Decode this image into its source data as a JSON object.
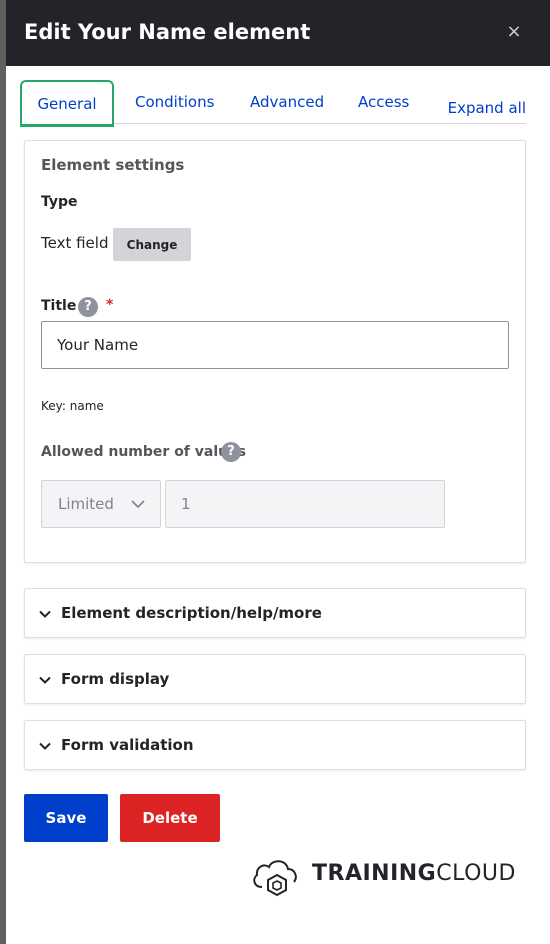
{
  "dialog": {
    "title": "Edit Your Name element",
    "close_glyph": "×"
  },
  "tabs": [
    {
      "label": "General",
      "active": true
    },
    {
      "label": "Conditions",
      "active": false
    },
    {
      "label": "Advanced",
      "active": false
    },
    {
      "label": "Access",
      "active": false
    }
  ],
  "expand_all_label": "Expand all",
  "element_settings": {
    "heading": "Element settings",
    "type_label": "Type",
    "type_value": "Text field",
    "change_button": "Change",
    "title_label": "Title",
    "help_glyph": "?",
    "required_mark": "*",
    "title_value": "Your Name",
    "key_text": "Key: name",
    "allowed_values_label": "Allowed number of values",
    "limit_select_value": "Limited",
    "limit_number_value": "1"
  },
  "sections": [
    {
      "label": "Element description/help/more"
    },
    {
      "label": "Form display"
    },
    {
      "label": "Form validation"
    }
  ],
  "actions": {
    "save": "Save",
    "delete": "Delete"
  },
  "logo": {
    "part_bold": "TRAINING",
    "part_light": "CLOUD"
  },
  "colors": {
    "titlebar_bg": "#232429",
    "link_blue": "#003ecc",
    "active_tab_border": "#26a769",
    "save_bg": "#003ecc",
    "delete_bg": "#dc2323",
    "required_red": "#dc2323"
  },
  "icons": {
    "close": "close-icon",
    "help": "help-icon",
    "chevron": "chevron-down-icon",
    "logo": "cloud-logo-icon"
  }
}
